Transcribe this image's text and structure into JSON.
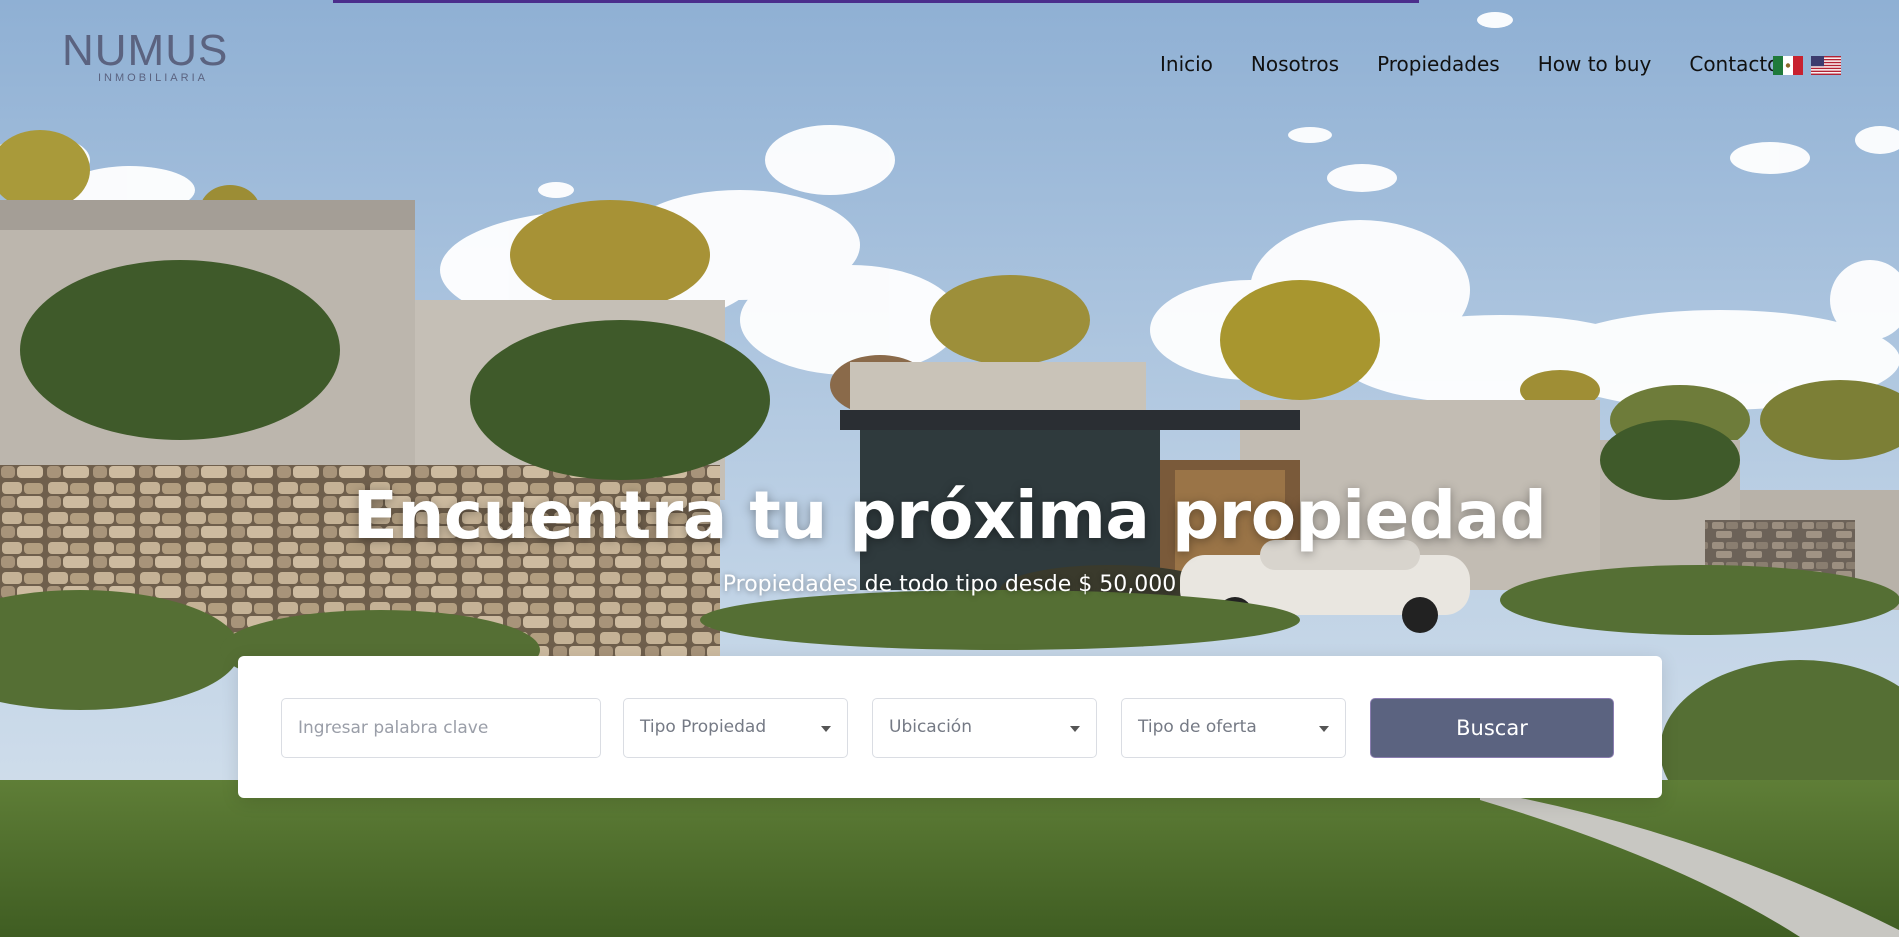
{
  "brand": {
    "name": "NUMUS",
    "tagline": "INMOBILIARIA",
    "color": "#5b6380"
  },
  "nav": {
    "items": [
      "Inicio",
      "Nosotros",
      "Propiedades",
      "How to buy",
      "Contacto"
    ]
  },
  "languages": [
    {
      "icon": "mexico-flag-icon"
    },
    {
      "icon": "usa-flag-icon"
    }
  ],
  "hero": {
    "title": "Encuentra tu próxima propiedad",
    "subtitle": "Propiedades de todo tipo desde $ 50,000"
  },
  "search": {
    "keyword_placeholder": "Ingresar palabra clave",
    "property_type": "Tipo Propiedad",
    "location": "Ubicación",
    "offer_type": "Tipo de oferta",
    "submit_label": "Buscar"
  },
  "colors": {
    "accent": "#5b6380",
    "top_bar": "#4b2d8c"
  }
}
